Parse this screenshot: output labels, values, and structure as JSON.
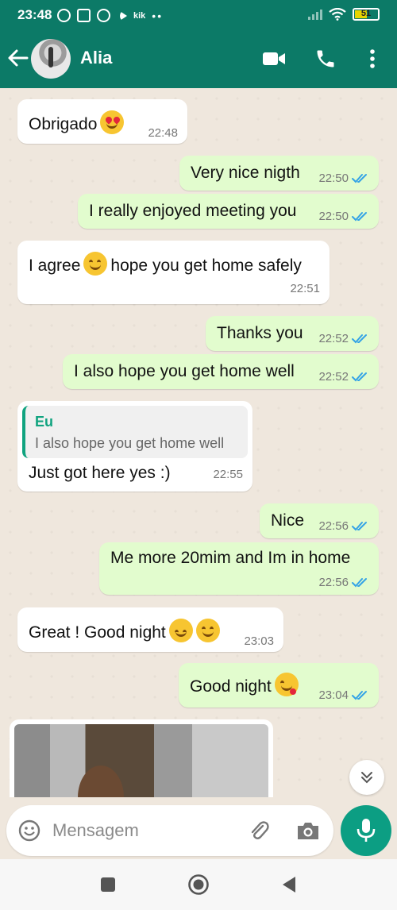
{
  "status_bar": {
    "time": "23:48",
    "kik_label": "kik",
    "battery_level": "51"
  },
  "header": {
    "contact_name": "Alia"
  },
  "messages": [
    {
      "dir": "in",
      "text": "Obrigado",
      "emoji": "heart-eyes-emoji",
      "time": "22:48"
    },
    {
      "dir": "out",
      "text": "Very nice nigth",
      "time": "22:50",
      "status": "read"
    },
    {
      "dir": "out",
      "text": "I really enjoyed meeting you",
      "time": "22:50",
      "status": "read"
    },
    {
      "dir": "in",
      "text_before": "I agree",
      "emoji": "smile-emoji",
      "text_after": "hope you get home safely",
      "time": "22:51"
    },
    {
      "dir": "out",
      "text": "Thanks you",
      "time": "22:52",
      "status": "read"
    },
    {
      "dir": "out",
      "text": "I also hope you get home well",
      "time": "22:52",
      "status": "read"
    },
    {
      "dir": "in",
      "quote_author": "Eu",
      "quote_text": "I also hope you get home well",
      "text": "Just got here yes :)",
      "time": "22:55"
    },
    {
      "dir": "out",
      "text": "Nice",
      "time": "22:56",
      "status": "read"
    },
    {
      "dir": "out",
      "text": "Me more 20mim and Im in home",
      "time": "22:56",
      "status": "read"
    },
    {
      "dir": "in",
      "text": "Great ! Good night",
      "emojis": [
        "sleepy-emoji",
        "smile-emoji"
      ],
      "time": "23:03"
    },
    {
      "dir": "out",
      "text": "Good night",
      "emoji": "kiss-emoji",
      "time": "23:04",
      "status": "read"
    }
  ],
  "composer": {
    "placeholder": "Mensagem"
  },
  "colors": {
    "header": "#0c7a67",
    "outgoing_bubble": "#e2fcce",
    "incoming_bubble": "#ffffff",
    "read_ticks": "#34a3e6",
    "mic_button": "#0c9e83",
    "chat_background": "#efe7dd"
  }
}
